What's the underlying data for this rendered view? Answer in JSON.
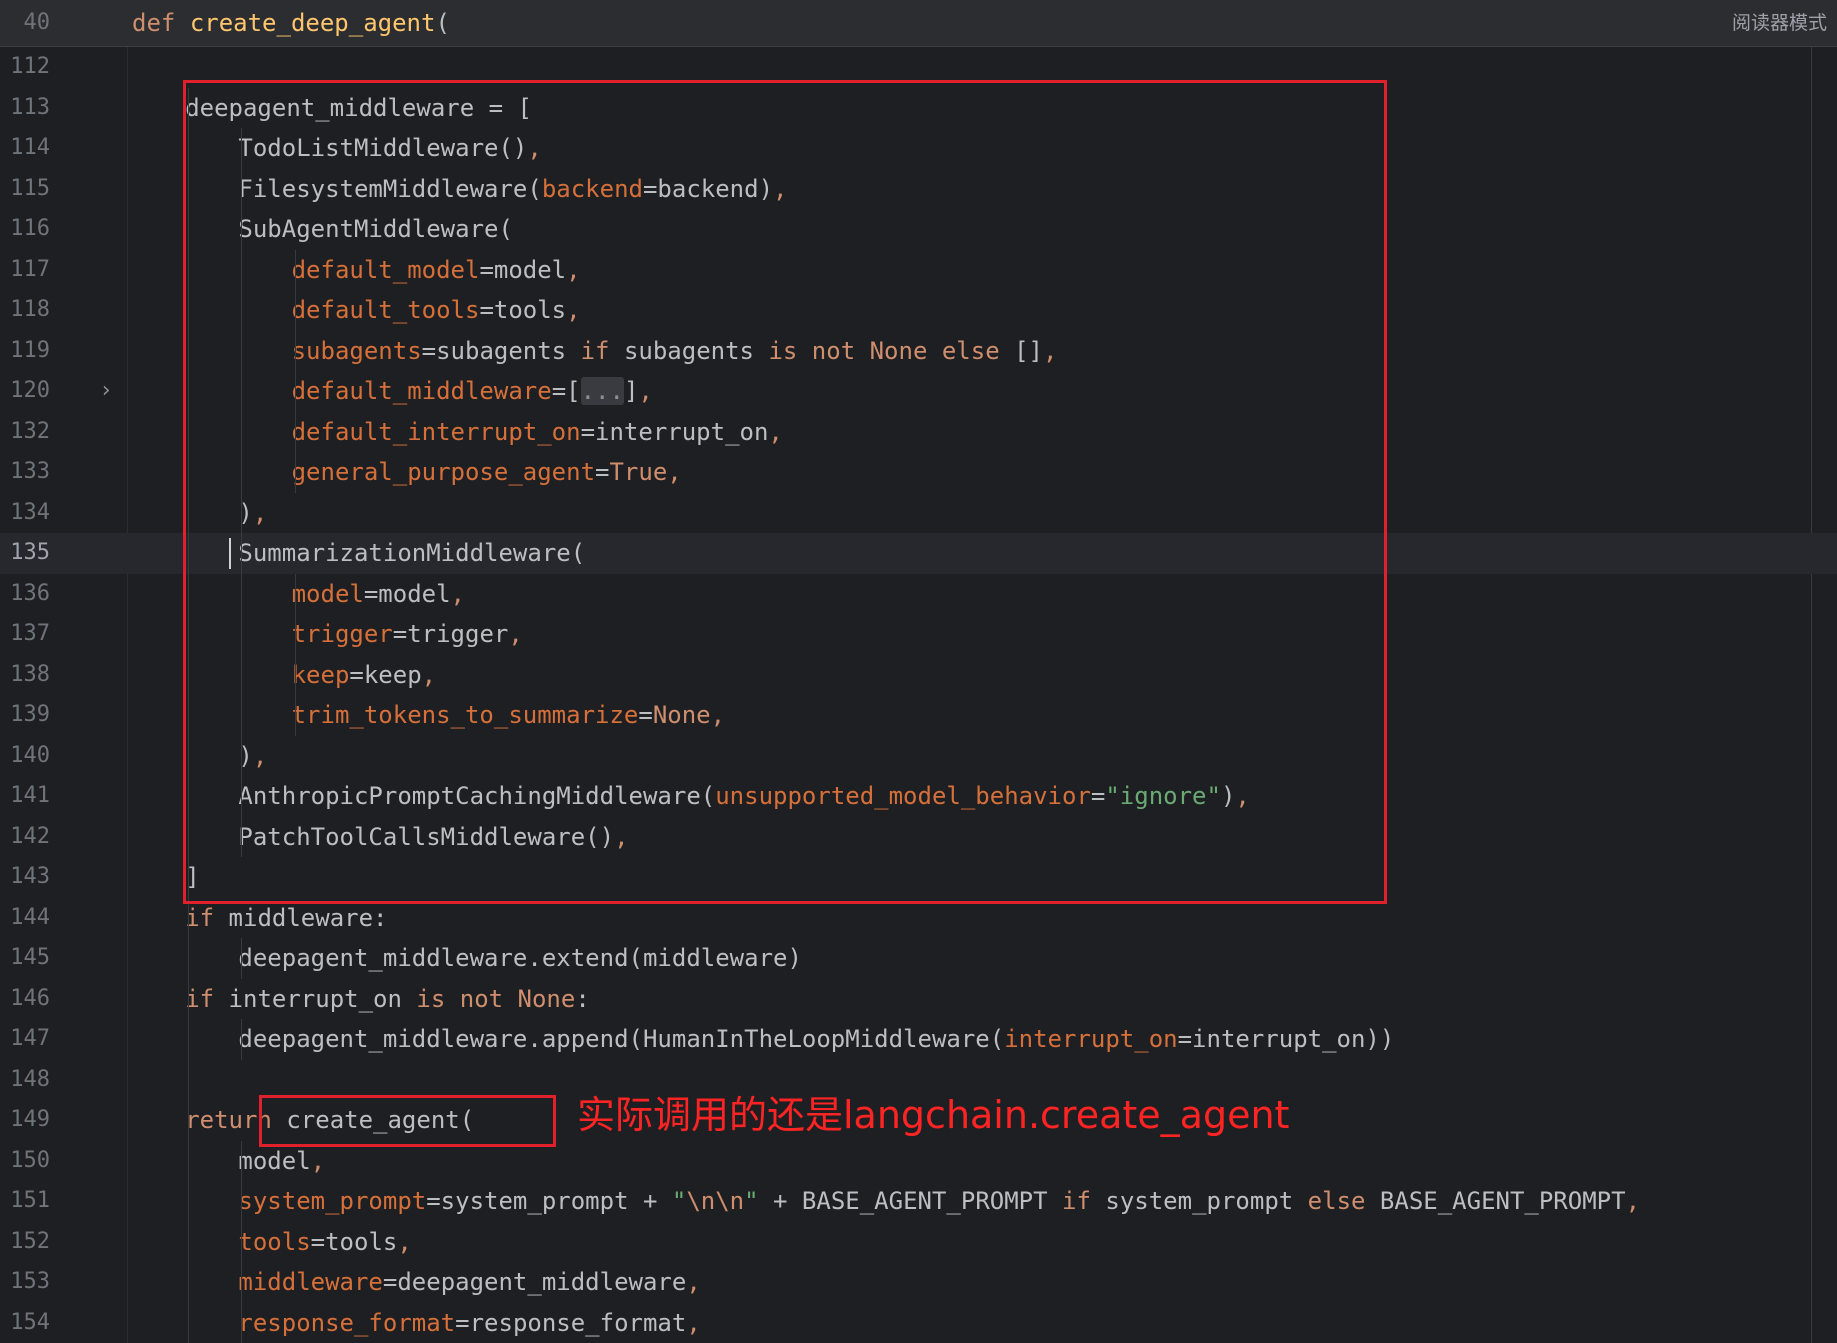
{
  "sticky_header": {
    "line_number": "40",
    "tokens": [
      {
        "t": "def",
        "c": "kw"
      },
      {
        "t": " ",
        "c": ""
      },
      {
        "t": "create_deep_agent",
        "c": "def"
      },
      {
        "t": "(",
        "c": ""
      }
    ]
  },
  "reader_mode_label": "阅读器模式",
  "annotation_text": "实际调用的还是langchain.create_agent",
  "colors": {
    "background": "#1e1f22",
    "keyword": "#cf8e6d",
    "function_def": "#ffc66d",
    "parameter": "#d6703a",
    "string": "#6aab73",
    "plain": "#bcbec4",
    "annotation_red": "#e0202a"
  },
  "current_line": "135",
  "code_lines": [
    {
      "ln": "112",
      "indent": 0,
      "tokens": []
    },
    {
      "ln": "113",
      "indent": 1,
      "tokens": [
        {
          "t": "deepagent_middleware = [",
          "c": ""
        }
      ]
    },
    {
      "ln": "114",
      "indent": 2,
      "tokens": [
        {
          "t": "TodoListMiddleware()",
          "c": ""
        },
        {
          "t": ",",
          "c": "kw"
        }
      ]
    },
    {
      "ln": "115",
      "indent": 2,
      "tokens": [
        {
          "t": "FilesystemMiddleware(",
          "c": ""
        },
        {
          "t": "backend",
          "c": "param"
        },
        {
          "t": "=backend)",
          "c": ""
        },
        {
          "t": ",",
          "c": "kw"
        }
      ]
    },
    {
      "ln": "116",
      "indent": 2,
      "tokens": [
        {
          "t": "SubAgentMiddleware(",
          "c": ""
        }
      ]
    },
    {
      "ln": "117",
      "indent": 3,
      "tokens": [
        {
          "t": "default_model",
          "c": "param"
        },
        {
          "t": "=model",
          "c": ""
        },
        {
          "t": ",",
          "c": "kw"
        }
      ]
    },
    {
      "ln": "118",
      "indent": 3,
      "tokens": [
        {
          "t": "default_tools",
          "c": "param"
        },
        {
          "t": "=tools",
          "c": ""
        },
        {
          "t": ",",
          "c": "kw"
        }
      ]
    },
    {
      "ln": "119",
      "indent": 3,
      "tokens": [
        {
          "t": "subagents",
          "c": "param"
        },
        {
          "t": "=subagents ",
          "c": ""
        },
        {
          "t": "if",
          "c": "kw"
        },
        {
          "t": " subagents ",
          "c": ""
        },
        {
          "t": "is not None else",
          "c": "kw"
        },
        {
          "t": " []",
          "c": ""
        },
        {
          "t": ",",
          "c": "kw"
        }
      ]
    },
    {
      "ln": "120",
      "indent": 3,
      "fold": true,
      "tokens": [
        {
          "t": "default_middleware",
          "c": "param"
        },
        {
          "t": "=[",
          "c": ""
        },
        {
          "t": "...",
          "c": "fold-ellipsis"
        },
        {
          "t": "]",
          "c": ""
        },
        {
          "t": ",",
          "c": "kw"
        }
      ]
    },
    {
      "ln": "132",
      "indent": 3,
      "tokens": [
        {
          "t": "default_interrupt_on",
          "c": "param"
        },
        {
          "t": "=interrupt_on",
          "c": ""
        },
        {
          "t": ",",
          "c": "kw"
        }
      ]
    },
    {
      "ln": "133",
      "indent": 3,
      "tokens": [
        {
          "t": "general_purpose_agent",
          "c": "param"
        },
        {
          "t": "=",
          "c": ""
        },
        {
          "t": "True",
          "c": "kw"
        },
        {
          "t": ",",
          "c": "kw"
        }
      ]
    },
    {
      "ln": "134",
      "indent": 2,
      "tokens": [
        {
          "t": ")",
          "c": ""
        },
        {
          "t": ",",
          "c": "kw"
        }
      ]
    },
    {
      "ln": "135",
      "indent": 2,
      "tokens": [
        {
          "t": "SummarizationMiddleware(",
          "c": ""
        }
      ]
    },
    {
      "ln": "136",
      "indent": 3,
      "tokens": [
        {
          "t": "model",
          "c": "param"
        },
        {
          "t": "=model",
          "c": ""
        },
        {
          "t": ",",
          "c": "kw"
        }
      ]
    },
    {
      "ln": "137",
      "indent": 3,
      "tokens": [
        {
          "t": "trigger",
          "c": "param"
        },
        {
          "t": "=trigger",
          "c": ""
        },
        {
          "t": ",",
          "c": "kw"
        }
      ]
    },
    {
      "ln": "138",
      "indent": 3,
      "tokens": [
        {
          "t": "keep",
          "c": "param"
        },
        {
          "t": "=keep",
          "c": ""
        },
        {
          "t": ",",
          "c": "kw"
        }
      ]
    },
    {
      "ln": "139",
      "indent": 3,
      "tokens": [
        {
          "t": "trim_tokens_to_summarize",
          "c": "param"
        },
        {
          "t": "=",
          "c": ""
        },
        {
          "t": "None",
          "c": "kw"
        },
        {
          "t": ",",
          "c": "kw"
        }
      ]
    },
    {
      "ln": "140",
      "indent": 2,
      "tokens": [
        {
          "t": ")",
          "c": ""
        },
        {
          "t": ",",
          "c": "kw"
        }
      ]
    },
    {
      "ln": "141",
      "indent": 2,
      "tokens": [
        {
          "t": "AnthropicPromptCachingMiddleware(",
          "c": ""
        },
        {
          "t": "unsupported_model_behavior",
          "c": "param"
        },
        {
          "t": "=",
          "c": ""
        },
        {
          "t": "\"ignore\"",
          "c": "str"
        },
        {
          "t": ")",
          "c": ""
        },
        {
          "t": ",",
          "c": "kw"
        }
      ]
    },
    {
      "ln": "142",
      "indent": 2,
      "tokens": [
        {
          "t": "PatchToolCallsMiddleware()",
          "c": ""
        },
        {
          "t": ",",
          "c": "kw"
        }
      ]
    },
    {
      "ln": "143",
      "indent": 1,
      "tokens": [
        {
          "t": "]",
          "c": ""
        }
      ]
    },
    {
      "ln": "144",
      "indent": 1,
      "tokens": [
        {
          "t": "if",
          "c": "kw"
        },
        {
          "t": " middleware:",
          "c": ""
        }
      ]
    },
    {
      "ln": "145",
      "indent": 2,
      "tokens": [
        {
          "t": "deepagent_middleware.extend(middleware)",
          "c": ""
        }
      ]
    },
    {
      "ln": "146",
      "indent": 1,
      "tokens": [
        {
          "t": "if",
          "c": "kw"
        },
        {
          "t": " interrupt_on ",
          "c": ""
        },
        {
          "t": "is not None",
          "c": "kw"
        },
        {
          "t": ":",
          "c": ""
        }
      ]
    },
    {
      "ln": "147",
      "indent": 2,
      "tokens": [
        {
          "t": "deepagent_middleware.append(HumanInTheLoopMiddleware(",
          "c": ""
        },
        {
          "t": "interrupt_on",
          "c": "param"
        },
        {
          "t": "=interrupt_on))",
          "c": ""
        }
      ]
    },
    {
      "ln": "148",
      "indent": 0,
      "tokens": []
    },
    {
      "ln": "149",
      "indent": 1,
      "tokens": [
        {
          "t": "return",
          "c": "kw"
        },
        {
          "t": " create_agent(",
          "c": ""
        }
      ]
    },
    {
      "ln": "150",
      "indent": 2,
      "tokens": [
        {
          "t": "model",
          "c": ""
        },
        {
          "t": ",",
          "c": "kw"
        }
      ]
    },
    {
      "ln": "151",
      "indent": 2,
      "tokens": [
        {
          "t": "system_prompt",
          "c": "param"
        },
        {
          "t": "=system_prompt + ",
          "c": ""
        },
        {
          "t": "\"",
          "c": "str"
        },
        {
          "t": "\\n\\n",
          "c": "esc"
        },
        {
          "t": "\"",
          "c": "str"
        },
        {
          "t": " + BASE_AGENT_PROMPT ",
          "c": ""
        },
        {
          "t": "if",
          "c": "kw"
        },
        {
          "t": " system_prompt ",
          "c": ""
        },
        {
          "t": "else",
          "c": "kw"
        },
        {
          "t": " BASE_AGENT_PROMPT",
          "c": ""
        },
        {
          "t": ",",
          "c": "kw"
        }
      ]
    },
    {
      "ln": "152",
      "indent": 2,
      "tokens": [
        {
          "t": "tools",
          "c": "param"
        },
        {
          "t": "=tools",
          "c": ""
        },
        {
          "t": ",",
          "c": "kw"
        }
      ]
    },
    {
      "ln": "153",
      "indent": 2,
      "tokens": [
        {
          "t": "middleware",
          "c": "param"
        },
        {
          "t": "=deepagent_middleware",
          "c": ""
        },
        {
          "t": ",",
          "c": "kw"
        }
      ]
    },
    {
      "ln": "154",
      "indent": 2,
      "tokens": [
        {
          "t": "response_format",
          "c": "param"
        },
        {
          "t": "=response_format",
          "c": ""
        },
        {
          "t": ",",
          "c": "kw"
        }
      ]
    }
  ]
}
